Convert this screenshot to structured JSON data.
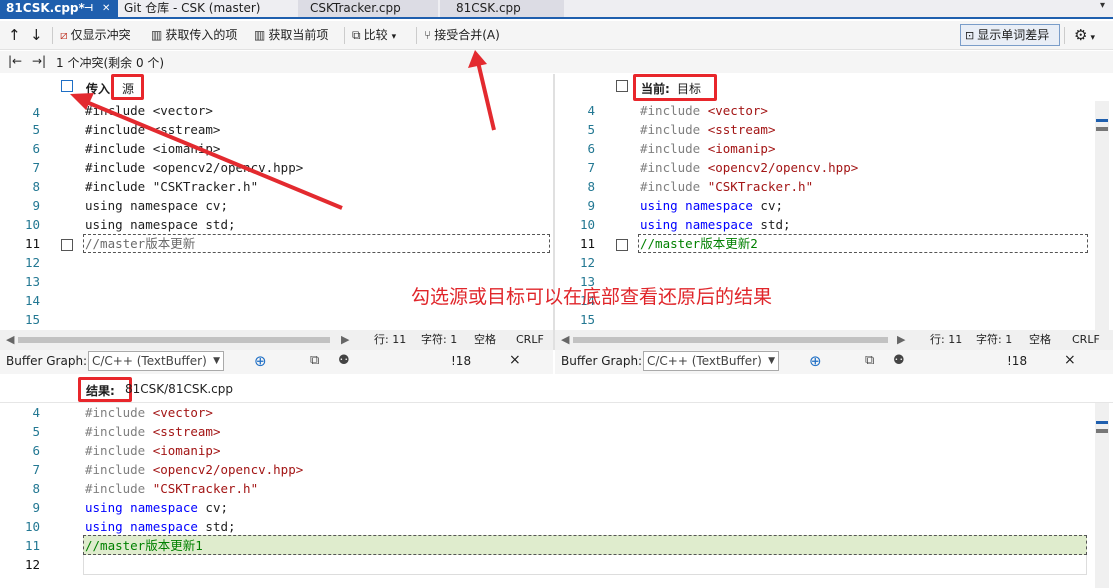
{
  "tabs": [
    {
      "label": "81CSK.cpp*",
      "active": true
    },
    {
      "label": "Git 仓库 - CSK (master)"
    },
    {
      "label": "CSKTracker.cpp"
    },
    {
      "label": "81CSK.cpp"
    }
  ],
  "toolbar": {
    "up": "↑",
    "down": "↓",
    "only_conflicts": "仅显示冲突",
    "take_incoming": "获取传入的项",
    "take_current": "获取当前项",
    "compare": "比较",
    "accept_merge": "接受合并(A)",
    "word_diff": "显示单词差异"
  },
  "nav": {
    "first": "|←",
    "last": "→|",
    "conflict_count": "1 个冲突(剩余 0 个)"
  },
  "incoming": {
    "label": "传入",
    "source": "源"
  },
  "current": {
    "label": "当前:",
    "target": "目标"
  },
  "result": {
    "label": "结果:",
    "path": "81CSK/81CSK.cpp"
  },
  "code_left": {
    "numbers": [
      "4",
      "5",
      "6",
      "7",
      "8",
      "9",
      "10",
      "11",
      "12",
      "13",
      "14",
      "15"
    ],
    "lines": [
      "#include <vector>",
      "#include <sstream>",
      "#include <iomanip>",
      "#include <opencv2/opencv.hpp>",
      "#include \"CSKTracker.h\"",
      "using namespace cv;",
      "using namespace std;",
      "//master版本更新"
    ]
  },
  "code_right": {
    "numbers": [
      "4",
      "5",
      "6",
      "7",
      "8",
      "9",
      "10",
      "11",
      "12",
      "13",
      "14",
      "15"
    ],
    "inc1": "#include ",
    "v1": "<vector>",
    "inc2": "#include ",
    "v2": "<sstream>",
    "inc3": "#include ",
    "v3": "<iomanip>",
    "inc4": "#include ",
    "v4": "<opencv2/opencv.hpp>",
    "inc5": "#include ",
    "v5": "\"CSKTracker.h\"",
    "kw_using": "using",
    "kw_namespace": "namespace",
    "cv": " cv;",
    "std": " std;",
    "comment": "//master版本更新2"
  },
  "code_result": {
    "numbers": [
      "4",
      "5",
      "6",
      "7",
      "8",
      "9",
      "10",
      "11",
      "12"
    ],
    "inc": "#include ",
    "v1": "<vector>",
    "v2": "<sstream>",
    "v3": "<iomanip>",
    "v4": "<opencv2/opencv.hpp>",
    "v5": "\"CSKTracker.h\"",
    "kw_using": "using",
    "kw_namespace": "namespace",
    "cv": " cv;",
    "std": " std;",
    "comment": "//master版本更新1"
  },
  "status_left": {
    "line": "行: 11",
    "char": "字符: 1",
    "space": "空格",
    "eol": "CRLF"
  },
  "status_right": {
    "line": "行: 11",
    "char": "字符: 1",
    "space": "空格",
    "eol": "CRLF"
  },
  "buffer": {
    "label": "Buffer Graph:",
    "value": "C/C++ (TextBuffer)",
    "count": "!18",
    "close": "×"
  },
  "annotation": "勾选源或目标可以在底部查看还原后的结果",
  "colors": {
    "accent": "#1f5fae",
    "red": "#e8262b",
    "keyword": "#0000ff",
    "comment": "#008000",
    "string": "#a31515"
  }
}
